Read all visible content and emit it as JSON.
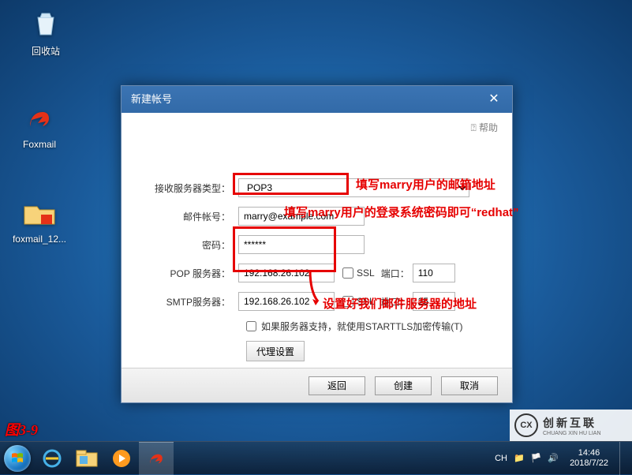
{
  "desktop_icons": {
    "recycle": "回收站",
    "foxmail": "Foxmail",
    "foxmail12": "foxmail_12..."
  },
  "dialog": {
    "title": "新建帐号",
    "help": "帮助",
    "labels": {
      "server_type": "接收服务器类型：",
      "account": "邮件帐号：",
      "password": "密码：",
      "pop": "POP 服务器：",
      "smtp": "SMTP服务器：",
      "ssl": "SSL",
      "port": "端口：",
      "starttls": "如果服务器支持，就使用STARTTLS加密传输(T)",
      "proxy": "代理设置"
    },
    "values": {
      "server_type": "POP3",
      "account": "marry@example.com",
      "password": "******",
      "pop": "192.168.26.102",
      "smtp": "192.168.26.102",
      "pop_port": "110",
      "smtp_port": "25"
    },
    "buttons": {
      "back": "返回",
      "create": "创建",
      "cancel": "取消"
    }
  },
  "annotations": {
    "a1": "填写marry用户的邮箱地址",
    "a2": "填写marry用户的登录系统密码即可“redhat”",
    "a3": "设置好我们邮件服务器的地址",
    "figno": "图3-9"
  },
  "taskbar": {
    "lang": "CH",
    "time": "14:46",
    "date": "2018/7/22"
  },
  "watermark": {
    "brand": "创新互联",
    "py": "CHUANG XIN HU LIAN"
  }
}
